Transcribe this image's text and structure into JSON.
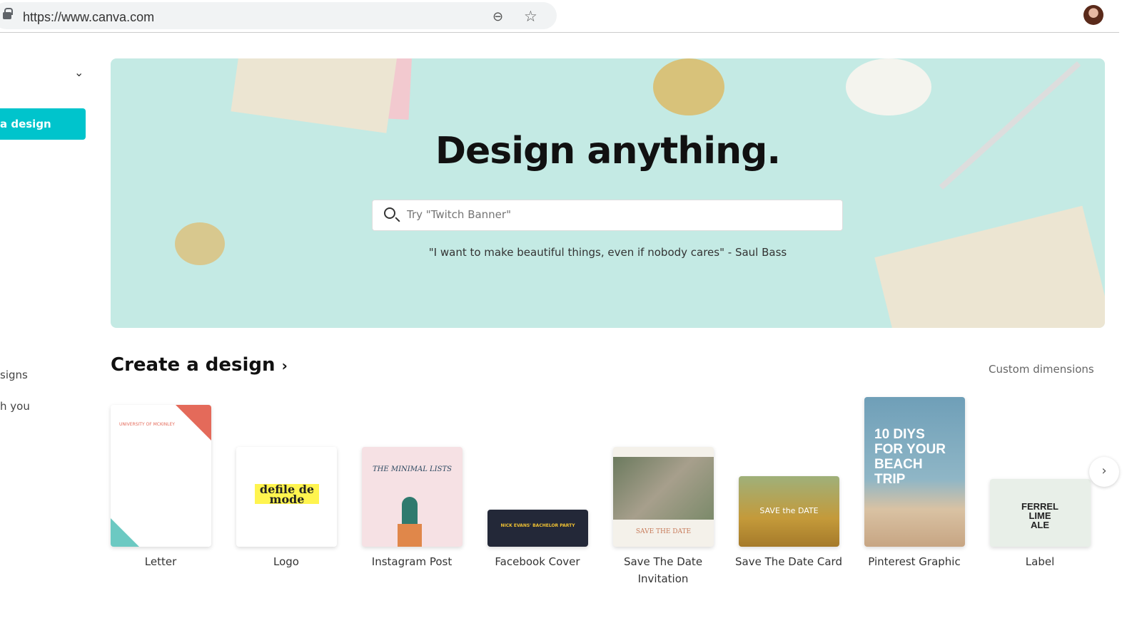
{
  "browser": {
    "url": "https://www.canva.com",
    "icons": [
      "lock-icon",
      "zoom-out-icon",
      "star-icon",
      "avatar"
    ]
  },
  "sidebar": {
    "create_button": "a design",
    "items": [
      "signs",
      "h you"
    ]
  },
  "hero": {
    "title": "Design anything.",
    "search_placeholder": "Try \"Twitch Banner\"",
    "quote": "\"I want to make beautiful things, even if nobody cares\" - Saul Bass"
  },
  "create": {
    "title": "Create a design",
    "chevron": "›",
    "custom": "Custom dimensions",
    "next": "›",
    "items": [
      {
        "label": "Letter",
        "thumb": "UNIVERSITY OF MCKINLEY"
      },
      {
        "label": "Logo",
        "thumb": "defile de mode"
      },
      {
        "label": "Instagram Post",
        "thumb": "THE MINIMAL LISTS"
      },
      {
        "label": "Facebook Cover",
        "thumb": "NICK EVANS' BACHELOR PARTY"
      },
      {
        "label": "Save The Date Invitation",
        "thumb": "SAVE THE DATE"
      },
      {
        "label": "Save The Date Card",
        "thumb": "SAVE the DATE"
      },
      {
        "label": "Pinterest Graphic",
        "thumb": "10 DIYS FOR YOUR BEACH TRIP"
      },
      {
        "label": "Label",
        "thumb": "FERREL LIME ALE"
      }
    ]
  },
  "colors": {
    "accent": "#00c4cc",
    "hero_bg": "#c4eae4"
  }
}
